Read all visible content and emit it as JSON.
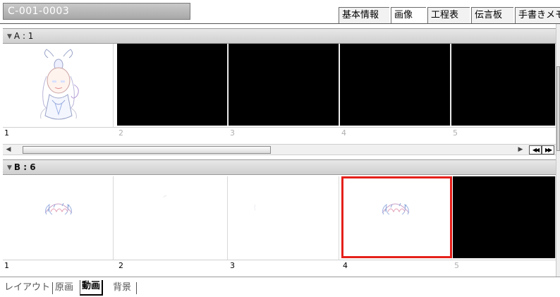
{
  "window": {
    "title": "C-001-0003"
  },
  "tabs": [
    {
      "label": "基本情報",
      "active": false
    },
    {
      "label": "画像",
      "active": true
    },
    {
      "label": "工程表",
      "active": false
    },
    {
      "label": "伝言板",
      "active": false
    },
    {
      "label": "手書きメモ",
      "active": false
    }
  ],
  "groups": [
    {
      "label": "A : 1",
      "cells": [
        {
          "number": "1",
          "content": "character-drawing",
          "dim": false
        },
        {
          "number": "2",
          "content": "black",
          "dim": true
        },
        {
          "number": "3",
          "content": "black",
          "dim": true
        },
        {
          "number": "4",
          "content": "black",
          "dim": true
        },
        {
          "number": "5",
          "content": "black",
          "dim": true
        }
      ]
    },
    {
      "label": "B : 6",
      "cells": [
        {
          "number": "1",
          "content": "hair-drawing",
          "dim": false
        },
        {
          "number": "2",
          "content": "faint-sketch",
          "dim": false
        },
        {
          "number": "3",
          "content": "faint-sketch",
          "dim": false
        },
        {
          "number": "4",
          "content": "hair-drawing",
          "dim": false,
          "selected": true
        },
        {
          "number": "5",
          "content": "black",
          "dim": true
        }
      ]
    }
  ],
  "bottom_tabs": [
    {
      "label": "レイアウト",
      "active": false
    },
    {
      "label": "原画",
      "active": false
    },
    {
      "label": "動画",
      "active": true
    },
    {
      "label": "背景",
      "active": false
    }
  ],
  "colors": {
    "selection": "#e5201b",
    "header_bg": "#d9d9d9"
  }
}
